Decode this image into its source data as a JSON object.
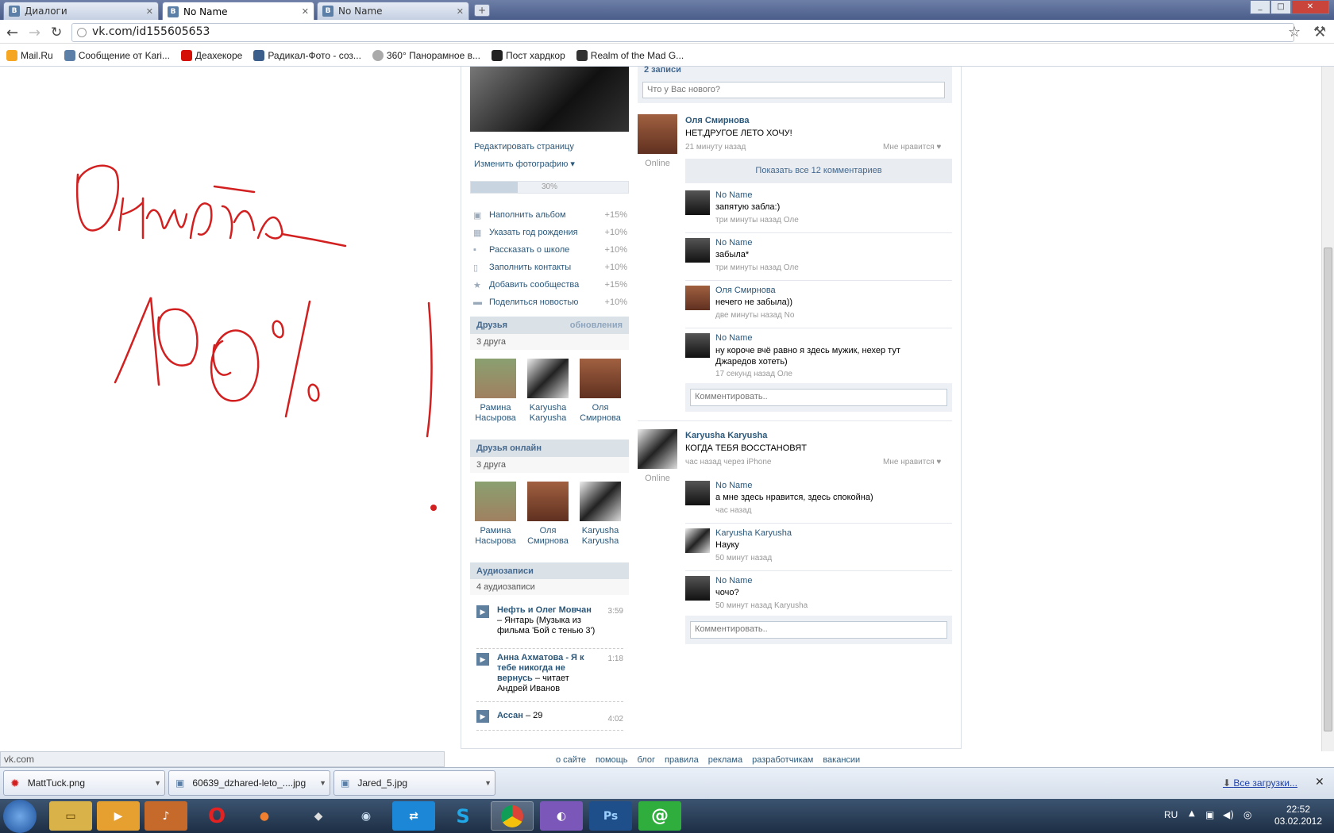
{
  "browser": {
    "tabs": [
      {
        "label": "Диалоги",
        "icon": "vk-icon"
      },
      {
        "label": "No Name",
        "icon": "vk-icon"
      },
      {
        "label": "No Name",
        "icon": "vk-icon"
      }
    ],
    "url": "vk.com/id155605653",
    "bookmarks": [
      "Mail.Ru",
      "Сообщение от Kari...",
      "Деахекоре",
      "Радикал-Фото - соз...",
      "360° Панорамное в...",
      "Пост хардкор",
      "Realm of the Mad G..."
    ],
    "status_text": "vk.com"
  },
  "annotation": {
    "word": "Онлайн",
    "percent": "100%",
    "color": "#d22020"
  },
  "profile": {
    "edit_page": "Редактировать страницу",
    "change_photo": "Изменить фотографию",
    "progress_label": "30%",
    "progress_value": 0.3,
    "tasks": [
      {
        "label": "Наполнить альбом",
        "bonus": "+15%"
      },
      {
        "label": "Указать год рождения",
        "bonus": "+10%"
      },
      {
        "label": "Рассказать о школе",
        "bonus": "+10%"
      },
      {
        "label": "Заполнить контакты",
        "bonus": "+10%"
      },
      {
        "label": "Добавить сообщества",
        "bonus": "+15%"
      },
      {
        "label": "Поделиться новостью",
        "bonus": "+10%"
      }
    ]
  },
  "friends": {
    "title": "Друзья",
    "updates": "обновления",
    "count": "3 друга",
    "list": [
      {
        "first": "Рамина",
        "last": "Насырова"
      },
      {
        "first": "Karyusha",
        "last": "Karyusha"
      },
      {
        "first": "Оля",
        "last": "Смирнова"
      }
    ]
  },
  "friends_online": {
    "title": "Друзья онлайн",
    "count": "3 друга",
    "list": [
      {
        "first": "Рамина",
        "last": "Насырова"
      },
      {
        "first": "Оля",
        "last": "Смирнова"
      },
      {
        "first": "Karyusha",
        "last": "Karyusha"
      }
    ]
  },
  "audio": {
    "title": "Аудиозаписи",
    "count": "4 аудиозаписи",
    "tracks": [
      {
        "artist": "Нефть и Олег Мовчан",
        "title": "– Янтарь (Музыка из фильма 'Бой с тенью 3')",
        "duration": "3:59"
      },
      {
        "artist": "Анна Ахматова - Я к тебе никогда не вернусь",
        "title": "– читает Андрей Иванов",
        "duration": "1:18"
      },
      {
        "artist": "Ассан",
        "title": "– 29",
        "duration": "4:02"
      }
    ]
  },
  "wall": {
    "header": "2 записи",
    "new_post_placeholder": "Что у Вас нового?",
    "posts": [
      {
        "author": "Оля Смирнова",
        "text": "НЕТ,ДРУГОЕ ЛЕТО ХОЧУ!",
        "time": "21 минуту назад",
        "like": "Мне нравится",
        "online": "Online",
        "show_all": "Показать все 12 комментариев",
        "comments": [
          {
            "author": "No Name",
            "text": "запятую забла:)",
            "meta": "три минуты назад Оле"
          },
          {
            "author": "No Name",
            "text": "забыла*",
            "meta": "три минуты назад Оле"
          },
          {
            "author": "Оля Смирнова",
            "text": "нечего не забыла))",
            "meta": "две минуты назад No"
          },
          {
            "author": "No Name",
            "text": "ну короче вчё равно я здесь мужик, нехер тут Джаредов хотеть)",
            "meta": "17 секунд назад Оле"
          }
        ],
        "comment_placeholder": "Комментировать.."
      },
      {
        "author": "Karyusha Karyusha",
        "text": "КОГДА ТЕБЯ ВОССТАНОВЯТ",
        "time": "час назад через iPhone",
        "like": "Мне нравится",
        "online": "Online",
        "comments": [
          {
            "author": "No Name",
            "text": "а мне здесь нравится, здесь спокойна)",
            "meta": "час назад"
          },
          {
            "author": "Karyusha Karyusha",
            "text": "Науку",
            "meta": "50 минут назад"
          },
          {
            "author": "No Name",
            "text": "чочо?",
            "meta": "50 минут назад Karyusha"
          }
        ],
        "comment_placeholder": "Комментировать.."
      }
    ]
  },
  "footer": [
    "о сайте",
    "помощь",
    "блог",
    "правила",
    "реклама",
    "разработчикам",
    "вакансии"
  ],
  "downloads": {
    "files": [
      "MattTuck.png",
      "60639_dzhared-leto_....jpg",
      "Jared_5.jpg"
    ],
    "all_label": "Все загрузки..."
  },
  "taskbar": {
    "lang": "RU",
    "time": "22:52",
    "date": "03.02.2012"
  }
}
